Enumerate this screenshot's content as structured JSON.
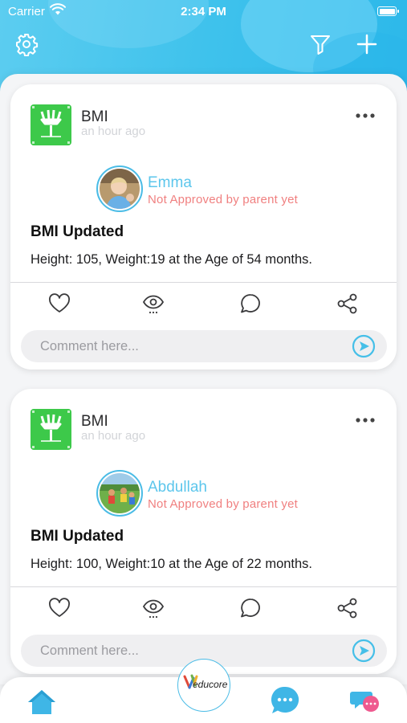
{
  "status_bar": {
    "carrier": "Carrier",
    "time": "2:34 PM"
  },
  "header": {
    "icons": [
      "gear-icon",
      "filter-icon",
      "plus-icon"
    ],
    "color": "#3fc2ec"
  },
  "posts": [
    {
      "title": "BMI",
      "time_ago": "an hour ago",
      "child_name": "Emma",
      "approval_status": "Not Approved by parent yet",
      "post_title": "BMI Updated",
      "post_body": "Height: 105, Weight:19 at the Age of 54 months.",
      "comment_placeholder": "Comment here..."
    },
    {
      "title": "BMI",
      "time_ago": "an hour ago",
      "child_name": "Abdullah",
      "approval_status": "Not Approved by parent yet",
      "post_title": "BMI Updated",
      "post_body": "Height: 100, Weight:10 at the Age of 22 months.",
      "comment_placeholder": "Comment here..."
    }
  ],
  "actions": [
    "heart-icon",
    "eye-icon",
    "comment-icon",
    "share-icon"
  ],
  "tab_bar": {
    "items": [
      "home-icon",
      "chat-icon",
      "messages-icon"
    ],
    "logo_text": "educore"
  },
  "colors": {
    "accent": "#5cc6ec",
    "warning": "#f08080",
    "icon_green": "#3dc94a"
  }
}
